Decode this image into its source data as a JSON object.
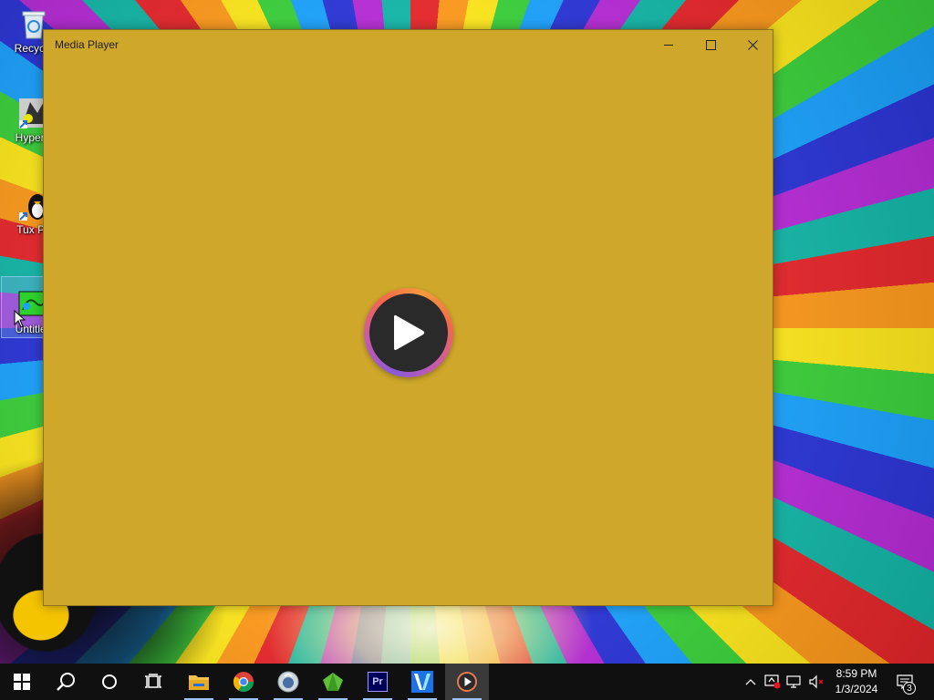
{
  "desktop": {
    "icons": [
      {
        "label": "Recycle",
        "icon": "recycle-bin-icon"
      },
      {
        "label": "HyperC",
        "icon": "hypercam-icon"
      },
      {
        "label": "Tux Pa",
        "icon": "tux-paint-icon"
      },
      {
        "label": "Untitled",
        "icon": "untitled-file-icon"
      }
    ]
  },
  "window": {
    "title": "Media Player",
    "background_color": "#cfa82b",
    "controls": {
      "minimize": "minimize-icon",
      "maximize": "maximize-icon",
      "close": "close-icon"
    },
    "center_control": "play-icon"
  },
  "taskbar": {
    "apps": [
      {
        "name": "start",
        "icon": "windows-start-icon"
      },
      {
        "name": "search",
        "icon": "search-icon"
      },
      {
        "name": "cortana",
        "icon": "cortana-circle-icon"
      },
      {
        "name": "task-view",
        "icon": "task-view-icon"
      },
      {
        "name": "file-explorer",
        "icon": "folder-icon"
      },
      {
        "name": "chrome",
        "icon": "chrome-icon"
      },
      {
        "name": "app-globe",
        "icon": "globe-app-icon"
      },
      {
        "name": "app-green",
        "icon": "green-gem-icon"
      },
      {
        "name": "premiere",
        "icon": "premiere-icon",
        "label": "Pr"
      },
      {
        "name": "vscode-like",
        "icon": "v-app-icon"
      },
      {
        "name": "media-player",
        "icon": "media-player-icon",
        "active": true
      }
    ],
    "tray": {
      "icons": [
        "chevron-up-icon",
        "security-warning-icon",
        "network-icon",
        "volume-muted-icon"
      ],
      "time": "8:59 PM",
      "date": "1/3/2024",
      "notification_count": "3"
    }
  }
}
